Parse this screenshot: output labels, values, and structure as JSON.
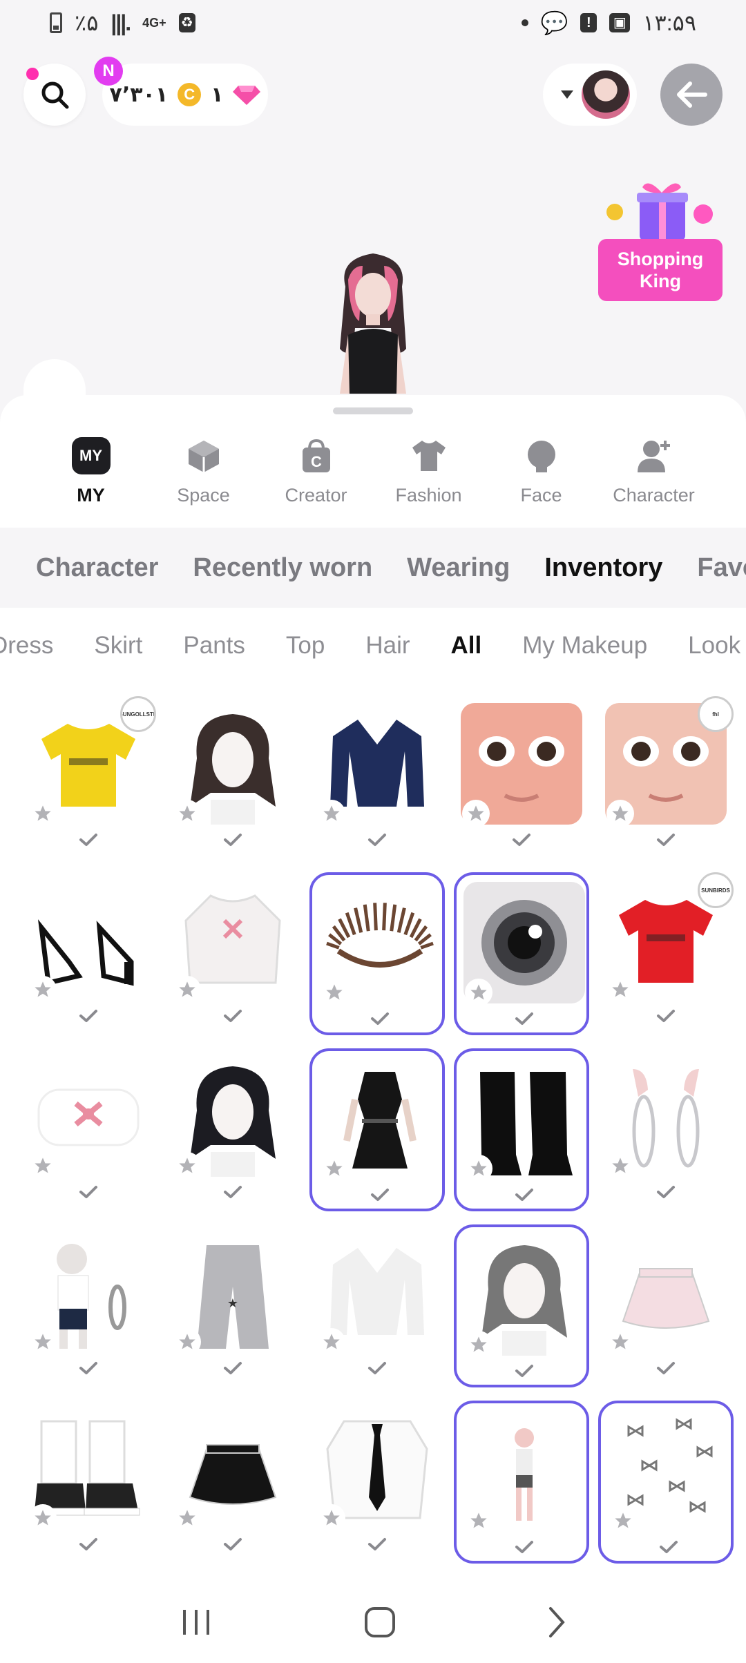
{
  "status_bar": {
    "battery": "٪۵",
    "network": "4G+",
    "time": "۱۳:۵۹"
  },
  "toolbar": {
    "n_badge": "N",
    "coins": "۷٬۳۰۱",
    "coin_symbol": "C",
    "gems": "۱"
  },
  "promo": {
    "label": "Shopping King"
  },
  "main_nav": [
    {
      "label": "MY",
      "icon": "my-icon",
      "icon_text": "MY",
      "active": true
    },
    {
      "label": "Space",
      "icon": "cube-icon"
    },
    {
      "label": "Creator",
      "icon": "bag-c-icon"
    },
    {
      "label": "Fashion",
      "icon": "tshirt-icon"
    },
    {
      "label": "Face",
      "icon": "head-icon"
    },
    {
      "label": "Character",
      "icon": "person-plus-icon"
    }
  ],
  "subtabs": [
    {
      "label": "Character"
    },
    {
      "label": "Recently worn"
    },
    {
      "label": "Wearing"
    },
    {
      "label": "Inventory",
      "active": true
    },
    {
      "label": "Favorit"
    }
  ],
  "categories": [
    {
      "label": "Dress"
    },
    {
      "label": "Skirt"
    },
    {
      "label": "Pants"
    },
    {
      "label": "Top"
    },
    {
      "label": "Hair"
    },
    {
      "label": "All",
      "active": true
    },
    {
      "label": "My Makeup"
    },
    {
      "label": "Look"
    }
  ],
  "items": [
    {
      "name": "yellow-jersey",
      "icon": "shirt",
      "color": "#f2d21a",
      "selected": false,
      "badge_text": "SUNGOLLSTH"
    },
    {
      "name": "curly-brown-hair",
      "icon": "hair",
      "color": "#3a2e2c",
      "selected": false
    },
    {
      "name": "navy-striped-jacket",
      "icon": "jacket",
      "color": "#1f2d5c",
      "selected": false
    },
    {
      "name": "face-preset-1",
      "icon": "face",
      "color": "#f0a998",
      "selected": false
    },
    {
      "name": "face-preset-2",
      "icon": "face",
      "color": "#f1c2b3",
      "selected": false,
      "badge_text": "fhl"
    },
    {
      "name": "black-heels",
      "icon": "heels",
      "color": "#111111",
      "selected": false
    },
    {
      "name": "white-bow-sweater",
      "icon": "sweater",
      "color": "#f3f0f0",
      "selected": false
    },
    {
      "name": "eyelashes",
      "icon": "lashes",
      "color": "#6b4632",
      "selected": true
    },
    {
      "name": "grey-eye",
      "icon": "eye",
      "color": "#3a3a3e",
      "selected": true
    },
    {
      "name": "red-jersey",
      "icon": "shirt",
      "color": "#e21f26",
      "selected": false,
      "badge_text": "SUNBIRDS"
    },
    {
      "name": "pink-bow-top",
      "icon": "bow-top",
      "color": "#f4d8de",
      "selected": false
    },
    {
      "name": "black-long-hair",
      "icon": "hair",
      "color": "#1c1c22",
      "selected": false
    },
    {
      "name": "black-mini-dress",
      "icon": "dress",
      "color": "#151515",
      "selected": true
    },
    {
      "name": "black-boots",
      "icon": "boots",
      "color": "#0e0e0e",
      "selected": true
    },
    {
      "name": "hoop-earrings",
      "icon": "earrings",
      "color": "#c8c8cc",
      "selected": false
    },
    {
      "name": "bracelet-body",
      "icon": "body",
      "color": "#1e2a44",
      "selected": false
    },
    {
      "name": "grey-cargo-pants",
      "icon": "pants",
      "color": "#b7b7bb",
      "selected": false
    },
    {
      "name": "white-top",
      "icon": "jacket",
      "color": "#f0f0f0",
      "selected": false
    },
    {
      "name": "wavy-grey-hair",
      "icon": "hair",
      "color": "#777777",
      "selected": true
    },
    {
      "name": "pink-ruffle-skirt",
      "icon": "skirt",
      "color": "#f4dde2",
      "selected": false
    },
    {
      "name": "white-sneakers",
      "icon": "sneakers",
      "color": "#222222",
      "selected": false
    },
    {
      "name": "black-ruffle-skirt",
      "icon": "skirt",
      "color": "#141414",
      "selected": false
    },
    {
      "name": "shirt-tie",
      "icon": "shirt-tie",
      "color": "#111111",
      "selected": false
    },
    {
      "name": "body-shape",
      "icon": "figure",
      "color": "#f1c9c6",
      "selected": true
    },
    {
      "name": "tiny-bows",
      "icon": "bows",
      "color": "#777777",
      "selected": true
    }
  ]
}
